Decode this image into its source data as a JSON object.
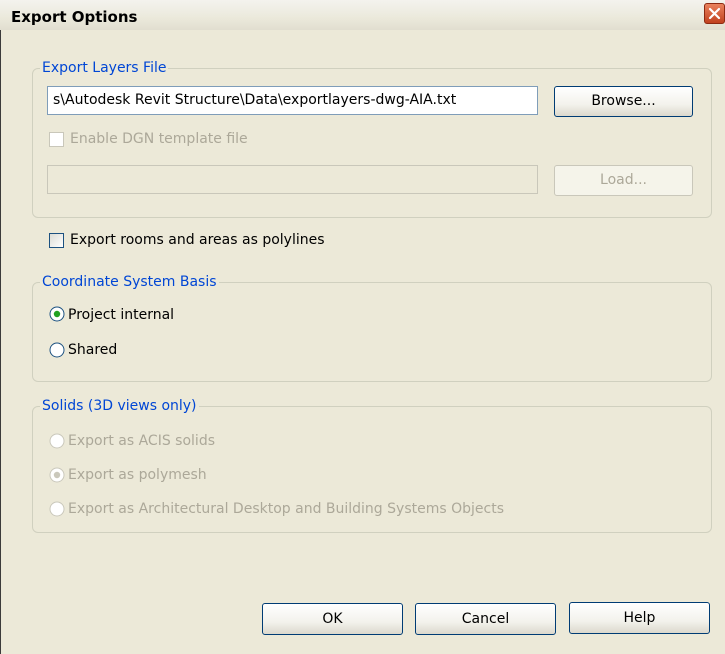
{
  "window": {
    "title": "Export Options"
  },
  "export_layers": {
    "legend": "Export Layers File",
    "file_path": "s\\Autodesk Revit Structure\\Data\\exportlayers-dwg-AIA.txt",
    "browse_label": "Browse...",
    "dgn_checkbox_label": "Enable DGN template file",
    "dgn_checked": false,
    "dgn_path": "",
    "load_label": "Load..."
  },
  "rooms_polylines": {
    "label": "Export rooms and areas as polylines",
    "checked": false
  },
  "coordinate": {
    "legend": "Coordinate System Basis",
    "options": [
      {
        "label": "Project internal",
        "selected": true
      },
      {
        "label": "Shared",
        "selected": false
      }
    ]
  },
  "solids": {
    "legend": "Solids (3D views only)",
    "options": [
      {
        "label": "Export as ACIS solids",
        "selected": false
      },
      {
        "label": "Export as polymesh",
        "selected": true
      },
      {
        "label": "Export as Architectural Desktop and Building Systems Objects",
        "selected": false
      }
    ]
  },
  "buttons": {
    "ok": "OK",
    "cancel": "Cancel",
    "help": "Help"
  },
  "colors": {
    "window_bg": "#ECE9D8",
    "legend_blue": "#0046d5",
    "disabled_text": "#aca899",
    "close_red": "#c1411f"
  }
}
